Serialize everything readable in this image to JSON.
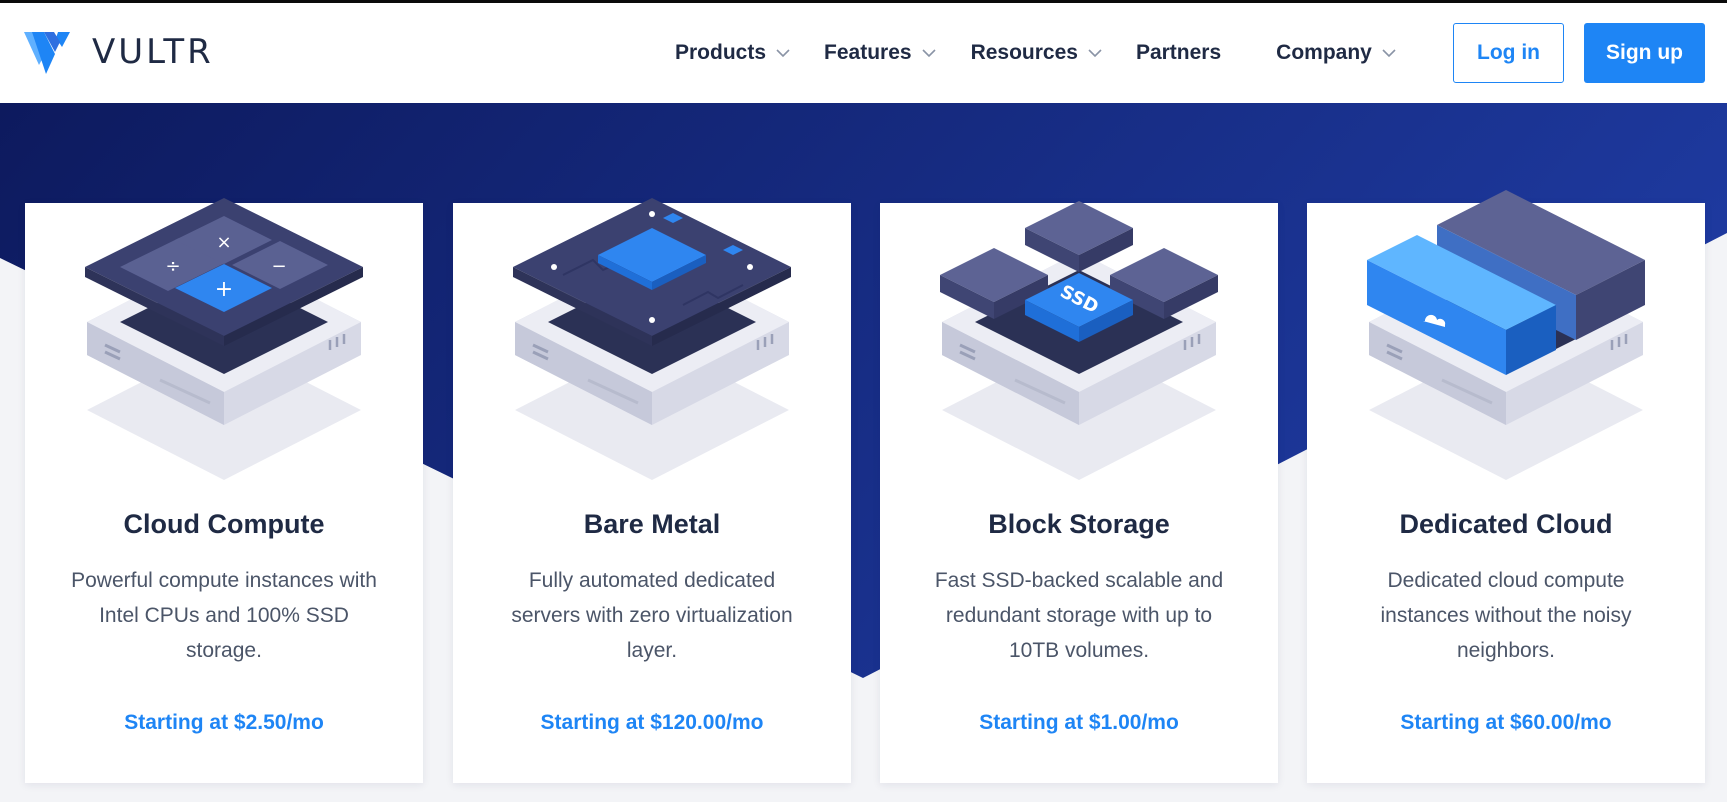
{
  "brand": {
    "name": "VULTR",
    "logo_icon": "vultr-logo-icon"
  },
  "nav": {
    "items": [
      {
        "label": "Products",
        "has_dropdown": true
      },
      {
        "label": "Features",
        "has_dropdown": true
      },
      {
        "label": "Resources",
        "has_dropdown": true
      },
      {
        "label": "Partners",
        "has_dropdown": false
      },
      {
        "label": "Company",
        "has_dropdown": true
      }
    ],
    "login_label": "Log in",
    "signup_label": "Sign up"
  },
  "cards": [
    {
      "icon": "calculator-server-icon",
      "title": "Cloud Compute",
      "description": "Powerful compute instances with Intel CPUs and 100% SSD storage.",
      "price": "Starting at $2.50/mo"
    },
    {
      "icon": "processor-server-icon",
      "title": "Bare Metal",
      "description": "Fully automated dedicated servers with zero virtualization layer.",
      "price": "Starting at $120.00/mo"
    },
    {
      "icon": "ssd-storage-icon",
      "title": "Block Storage",
      "description": "Fast SSD-backed scalable and redundant storage with up to 10TB volumes.",
      "price": "Starting at $1.00/mo"
    },
    {
      "icon": "dedicated-cloud-icon",
      "title": "Dedicated Cloud",
      "description": "Dedicated cloud compute instances without the noisy neighbors.",
      "price": "Starting at $60.00/mo"
    }
  ],
  "icons": {
    "ssd_label": "SSD"
  },
  "colors": {
    "accent": "#1e85f5",
    "hero_dark": "#0d1a5e",
    "hero_light": "#1e3aa0",
    "text_dark": "#1f2a44",
    "text_body": "#4b5568",
    "page_bg": "#f3f4f7"
  }
}
